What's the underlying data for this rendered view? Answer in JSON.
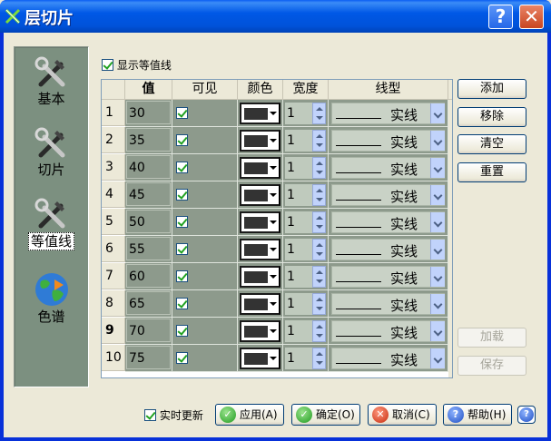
{
  "window": {
    "title": "层切片",
    "help_button": "?",
    "close_button": "✕"
  },
  "nav": [
    {
      "label": "基本",
      "icon": "wrench-hammer-icon"
    },
    {
      "label": "切片",
      "icon": "wrench-hammer-icon"
    },
    {
      "label": "等值线",
      "icon": "wrench-hammer-icon",
      "active": true
    },
    {
      "label": "色谱",
      "icon": "globe-icon"
    }
  ],
  "show_contour": {
    "label": "显示等值线",
    "checked": true
  },
  "table": {
    "headers": {
      "value": "值",
      "visible": "可见",
      "color": "颜色",
      "width": "宽度",
      "linetype": "线型"
    },
    "rows": [
      {
        "index": "1",
        "value": "30",
        "visible": true,
        "color": "#333333",
        "width": "1",
        "linetype": "实线"
      },
      {
        "index": "2",
        "value": "35",
        "visible": true,
        "color": "#333333",
        "width": "1",
        "linetype": "实线"
      },
      {
        "index": "3",
        "value": "40",
        "visible": true,
        "color": "#333333",
        "width": "1",
        "linetype": "实线"
      },
      {
        "index": "4",
        "value": "45",
        "visible": true,
        "color": "#333333",
        "width": "1",
        "linetype": "实线"
      },
      {
        "index": "5",
        "value": "50",
        "visible": true,
        "color": "#333333",
        "width": "1",
        "linetype": "实线"
      },
      {
        "index": "6",
        "value": "55",
        "visible": true,
        "color": "#333333",
        "width": "1",
        "linetype": "实线"
      },
      {
        "index": "7",
        "value": "60",
        "visible": true,
        "color": "#333333",
        "width": "1",
        "linetype": "实线"
      },
      {
        "index": "8",
        "value": "65",
        "visible": true,
        "color": "#333333",
        "width": "1",
        "linetype": "实线"
      },
      {
        "index": "9",
        "value": "70",
        "visible": true,
        "color": "#333333",
        "width": "1",
        "linetype": "实线",
        "current": true
      },
      {
        "index": "10",
        "value": "75",
        "visible": true,
        "color": "#333333",
        "width": "1",
        "linetype": "实线"
      }
    ]
  },
  "side_buttons": {
    "add": "添加",
    "remove": "移除",
    "clear": "清空",
    "reset": "重置",
    "load": "加载",
    "save": "保存"
  },
  "footer": {
    "realtime": {
      "label": "实时更新",
      "checked": true
    },
    "apply": "应用(A)",
    "ok": "确定(O)",
    "cancel": "取消(C)",
    "help": "帮助(H)"
  }
}
